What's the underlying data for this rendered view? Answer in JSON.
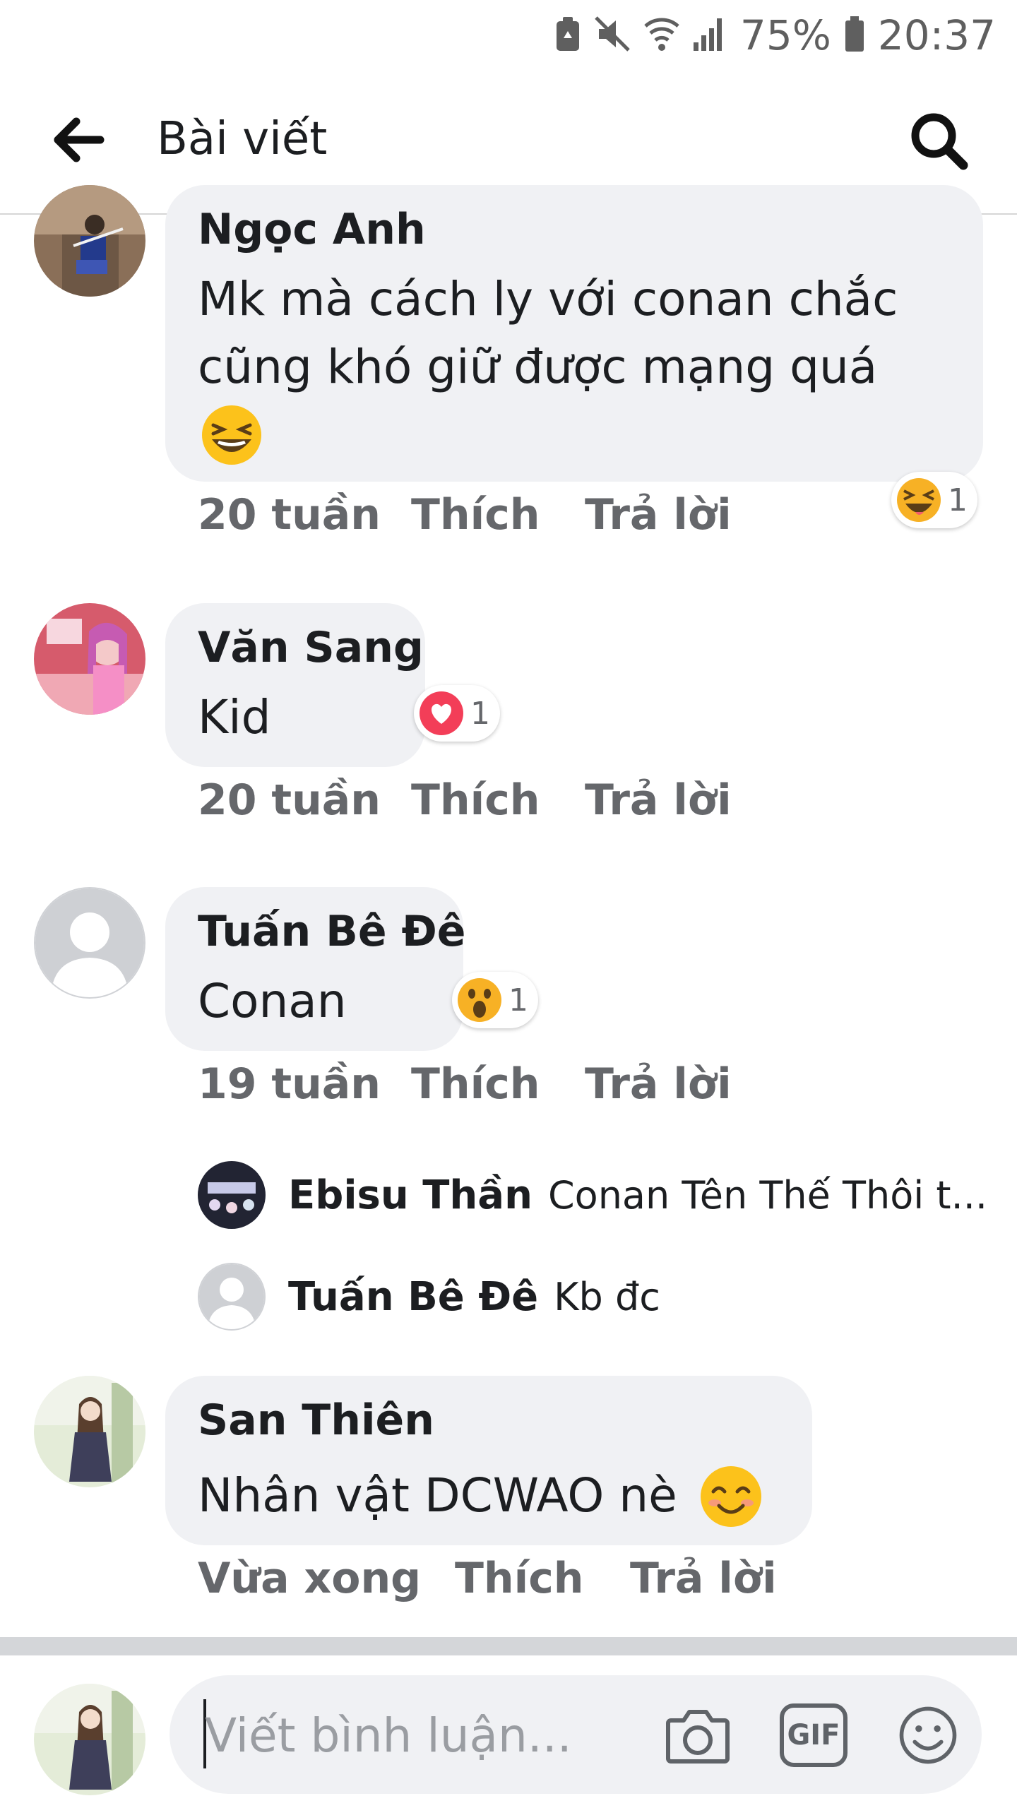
{
  "status_bar": {
    "battery": "75%",
    "time": "20:37",
    "icons": [
      "recycle-icon",
      "mute-icon",
      "wifi-icon",
      "signal-icon",
      "battery-icon"
    ]
  },
  "header": {
    "title": "Bài viết",
    "back_icon": "arrow-left-icon",
    "search_icon": "search-icon"
  },
  "comments": [
    {
      "name": "Ngọc Anh",
      "text_lines": [
        "Mk mà cách ly với conan chắc",
        "cũng khó giữ được mạng quá"
      ],
      "emoji": "laughing-emoji",
      "time": "20 tuần",
      "like": "Thích",
      "reply": "Trả lời",
      "reaction": {
        "icon": "haha-reaction-icon",
        "count": "1"
      }
    },
    {
      "name": "Văn Sang",
      "text": "Kid",
      "time": "20 tuần",
      "like": "Thích",
      "reply": "Trả lời",
      "reaction": {
        "icon": "love-reaction-icon",
        "count": "1"
      }
    },
    {
      "name": "Tuấn Bê Đê",
      "text": "Conan",
      "time": "19 tuần",
      "like": "Thích",
      "reply": "Trả lời",
      "reaction": {
        "icon": "wow-reaction-icon",
        "count": "1"
      },
      "replies": [
        {
          "name": "Ebisu Thần",
          "text": "Conan Tên Thế Thôi t..."
        },
        {
          "name": "Tuấn Bê Đê",
          "text": "Kb đc"
        }
      ]
    },
    {
      "name": "San Thiên",
      "text": "Nhân vật DCWAO nè",
      "emoji": "smiling-emoji",
      "time": "Vừa xong",
      "like": "Thích",
      "reply": "Trả lời"
    }
  ],
  "composer": {
    "placeholder": "Viết bình luận...",
    "icons": [
      "camera-icon",
      "gif-icon",
      "emoji-icon"
    ],
    "gif_label": "GIF"
  },
  "colors": {
    "bubble": "#f0f1f4",
    "meta_text": "#65676b",
    "divider": "#d4d6d9",
    "love": "#f33e58",
    "haha": "#f7b125"
  }
}
